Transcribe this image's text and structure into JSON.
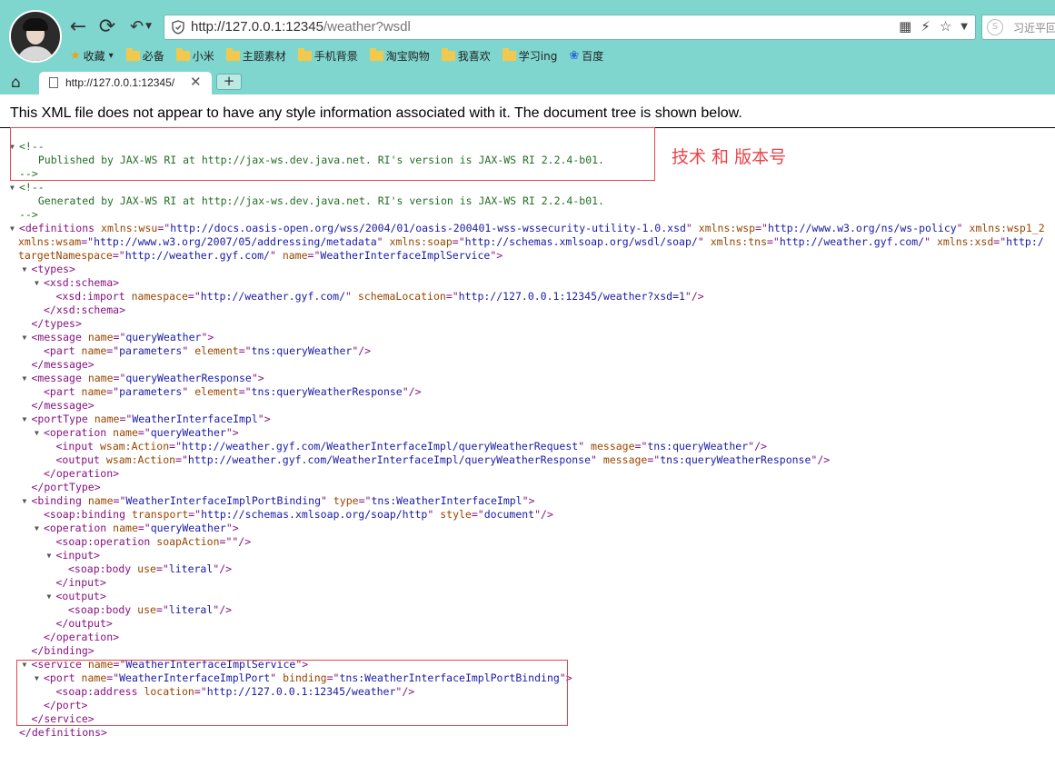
{
  "browser": {
    "address_url": "http://127.0.0.1:12345",
    "address_url_rest": "/weather?wsdl",
    "search_placeholder": "习近平回",
    "tab_title": "http://127.0.0.1:12345/",
    "new_tab_label": "+",
    "bookmarks": [
      {
        "label": "收藏",
        "icon": "star-icon"
      },
      {
        "label": "必备",
        "icon": "folder-icon"
      },
      {
        "label": "小米",
        "icon": "folder-icon"
      },
      {
        "label": "主题素材",
        "icon": "folder-icon"
      },
      {
        "label": "手机背景",
        "icon": "folder-icon"
      },
      {
        "label": "淘宝购物",
        "icon": "folder-icon"
      },
      {
        "label": "我喜欢",
        "icon": "folder-icon"
      },
      {
        "label": "学习ing",
        "icon": "folder-icon"
      },
      {
        "label": "百度",
        "icon": "baidu-paw-icon"
      }
    ],
    "theme_color": "#7fd6cf"
  },
  "page": {
    "info_message": "This XML file does not appear to have any style information associated with it. The document tree is shown below.",
    "annotation_text": "技术  和 版本号",
    "annotation_color": "#e8454a"
  },
  "xml_lines": [
    {
      "tri": true,
      "segs": [
        {
          "c": "cm",
          "t": "<!--"
        }
      ]
    },
    {
      "tri": false,
      "segs": [
        {
          "c": "cm",
          "t": "  Published by JAX-WS RI at http://jax-ws.dev.java.net. RI's version is JAX-WS RI 2.2.4-b01."
        }
      ]
    },
    {
      "tri": false,
      "segs": [
        {
          "c": "cm",
          "t": "-->"
        }
      ]
    },
    {
      "tri": true,
      "segs": [
        {
          "c": "cm",
          "t": "<!--"
        }
      ]
    },
    {
      "tri": false,
      "segs": [
        {
          "c": "cm",
          "t": "  Generated by JAX-WS RI at http://jax-ws.dev.java.net. RI's version is JAX-WS RI 2.2.4-b01."
        }
      ]
    },
    {
      "tri": false,
      "segs": [
        {
          "c": "cm",
          "t": "-->"
        }
      ]
    },
    {
      "tri": true,
      "segs": [
        {
          "c": "tg",
          "t": "<definitions "
        },
        {
          "c": "an",
          "t": "xmlns:wsu"
        },
        {
          "c": "tg",
          "t": "=\""
        },
        {
          "c": "av",
          "t": "http://docs.oasis-open.org/wss/2004/01/oasis-200401-wss-wssecurity-utility-1.0.xsd"
        },
        {
          "c": "tg",
          "t": "\" "
        },
        {
          "c": "an",
          "t": "xmlns:wsp"
        },
        {
          "c": "tg",
          "t": "=\""
        },
        {
          "c": "av",
          "t": "http://www.w3.org/ns/ws-policy"
        },
        {
          "c": "tg",
          "t": "\" "
        },
        {
          "c": "an",
          "t": "xmlns:wsp1_2"
        }
      ]
    },
    {
      "tri": false,
      "segs": [
        {
          "c": "an",
          "t": "xmlns:wsam"
        },
        {
          "c": "tg",
          "t": "=\""
        },
        {
          "c": "av",
          "t": "http://www.w3.org/2007/05/addressing/metadata"
        },
        {
          "c": "tg",
          "t": "\" "
        },
        {
          "c": "an",
          "t": "xmlns:soap"
        },
        {
          "c": "tg",
          "t": "=\""
        },
        {
          "c": "av",
          "t": "http://schemas.xmlsoap.org/wsdl/soap/"
        },
        {
          "c": "tg",
          "t": "\" "
        },
        {
          "c": "an",
          "t": "xmlns:tns"
        },
        {
          "c": "tg",
          "t": "=\""
        },
        {
          "c": "av",
          "t": "http://weather.gyf.com/"
        },
        {
          "c": "tg",
          "t": "\" "
        },
        {
          "c": "an",
          "t": "xmlns:xsd"
        },
        {
          "c": "tg",
          "t": "=\""
        },
        {
          "c": "av",
          "t": "http:/"
        }
      ]
    },
    {
      "tri": false,
      "segs": [
        {
          "c": "an",
          "t": "targetNamespace"
        },
        {
          "c": "tg",
          "t": "=\""
        },
        {
          "c": "av",
          "t": "http://weather.gyf.com/"
        },
        {
          "c": "tg",
          "t": "\" "
        },
        {
          "c": "an",
          "t": "name"
        },
        {
          "c": "tg",
          "t": "=\""
        },
        {
          "c": "av",
          "t": "WeatherInterfaceImplService"
        },
        {
          "c": "tg",
          "t": "\">"
        }
      ]
    },
    {
      "tri": true,
      "segs": [
        {
          "c": "tg",
          "t": "<types>"
        }
      ]
    },
    {
      "tri": true,
      "segs": [
        {
          "c": "tg",
          "t": "<xsd:schema>"
        }
      ]
    },
    {
      "tri": false,
      "segs": [
        {
          "c": "tg",
          "t": "<xsd:import "
        },
        {
          "c": "an",
          "t": "namespace"
        },
        {
          "c": "tg",
          "t": "=\""
        },
        {
          "c": "av",
          "t": "http://weather.gyf.com/"
        },
        {
          "c": "tg",
          "t": "\" "
        },
        {
          "c": "an",
          "t": "schemaLocation"
        },
        {
          "c": "tg",
          "t": "=\""
        },
        {
          "c": "av",
          "t": "http://127.0.0.1:12345/weather?xsd=1"
        },
        {
          "c": "tg",
          "t": "\"/>"
        }
      ]
    },
    {
      "tri": false,
      "segs": [
        {
          "c": "tg",
          "t": "</xsd:schema>"
        }
      ]
    },
    {
      "tri": false,
      "segs": [
        {
          "c": "tg",
          "t": "</types>"
        }
      ]
    },
    {
      "tri": true,
      "segs": [
        {
          "c": "tg",
          "t": "<message "
        },
        {
          "c": "an",
          "t": "name"
        },
        {
          "c": "tg",
          "t": "=\""
        },
        {
          "c": "av",
          "t": "queryWeather"
        },
        {
          "c": "tg",
          "t": "\">"
        }
      ]
    },
    {
      "tri": false,
      "segs": [
        {
          "c": "tg",
          "t": "<part "
        },
        {
          "c": "an",
          "t": "name"
        },
        {
          "c": "tg",
          "t": "=\""
        },
        {
          "c": "av",
          "t": "parameters"
        },
        {
          "c": "tg",
          "t": "\" "
        },
        {
          "c": "an",
          "t": "element"
        },
        {
          "c": "tg",
          "t": "=\""
        },
        {
          "c": "av",
          "t": "tns:queryWeather"
        },
        {
          "c": "tg",
          "t": "\"/>"
        }
      ]
    },
    {
      "tri": false,
      "segs": [
        {
          "c": "tg",
          "t": "</message>"
        }
      ]
    },
    {
      "tri": true,
      "segs": [
        {
          "c": "tg",
          "t": "<message "
        },
        {
          "c": "an",
          "t": "name"
        },
        {
          "c": "tg",
          "t": "=\""
        },
        {
          "c": "av",
          "t": "queryWeatherResponse"
        },
        {
          "c": "tg",
          "t": "\">"
        }
      ]
    },
    {
      "tri": false,
      "segs": [
        {
          "c": "tg",
          "t": "<part "
        },
        {
          "c": "an",
          "t": "name"
        },
        {
          "c": "tg",
          "t": "=\""
        },
        {
          "c": "av",
          "t": "parameters"
        },
        {
          "c": "tg",
          "t": "\" "
        },
        {
          "c": "an",
          "t": "element"
        },
        {
          "c": "tg",
          "t": "=\""
        },
        {
          "c": "av",
          "t": "tns:queryWeatherResponse"
        },
        {
          "c": "tg",
          "t": "\"/>"
        }
      ]
    },
    {
      "tri": false,
      "segs": [
        {
          "c": "tg",
          "t": "</message>"
        }
      ]
    },
    {
      "tri": true,
      "segs": [
        {
          "c": "tg",
          "t": "<portType "
        },
        {
          "c": "an",
          "t": "name"
        },
        {
          "c": "tg",
          "t": "=\""
        },
        {
          "c": "av",
          "t": "WeatherInterfaceImpl"
        },
        {
          "c": "tg",
          "t": "\">"
        }
      ]
    },
    {
      "tri": true,
      "segs": [
        {
          "c": "tg",
          "t": "<operation "
        },
        {
          "c": "an",
          "t": "name"
        },
        {
          "c": "tg",
          "t": "=\""
        },
        {
          "c": "av",
          "t": "queryWeather"
        },
        {
          "c": "tg",
          "t": "\">"
        }
      ]
    },
    {
      "tri": false,
      "segs": [
        {
          "c": "tg",
          "t": "<input "
        },
        {
          "c": "an",
          "t": "wsam:Action"
        },
        {
          "c": "tg",
          "t": "=\""
        },
        {
          "c": "av",
          "t": "http://weather.gyf.com/WeatherInterfaceImpl/queryWeatherRequest"
        },
        {
          "c": "tg",
          "t": "\" "
        },
        {
          "c": "an",
          "t": "message"
        },
        {
          "c": "tg",
          "t": "=\""
        },
        {
          "c": "av",
          "t": "tns:queryWeather"
        },
        {
          "c": "tg",
          "t": "\"/>"
        }
      ]
    },
    {
      "tri": false,
      "segs": [
        {
          "c": "tg",
          "t": "<output "
        },
        {
          "c": "an",
          "t": "wsam:Action"
        },
        {
          "c": "tg",
          "t": "=\""
        },
        {
          "c": "av",
          "t": "http://weather.gyf.com/WeatherInterfaceImpl/queryWeatherResponse"
        },
        {
          "c": "tg",
          "t": "\" "
        },
        {
          "c": "an",
          "t": "message"
        },
        {
          "c": "tg",
          "t": "=\""
        },
        {
          "c": "av",
          "t": "tns:queryWeatherResponse"
        },
        {
          "c": "tg",
          "t": "\"/>"
        }
      ]
    },
    {
      "tri": false,
      "segs": [
        {
          "c": "tg",
          "t": "</operation>"
        }
      ]
    },
    {
      "tri": false,
      "segs": [
        {
          "c": "tg",
          "t": "</portType>"
        }
      ]
    },
    {
      "tri": true,
      "segs": [
        {
          "c": "tg",
          "t": "<binding "
        },
        {
          "c": "an",
          "t": "name"
        },
        {
          "c": "tg",
          "t": "=\""
        },
        {
          "c": "av",
          "t": "WeatherInterfaceImplPortBinding"
        },
        {
          "c": "tg",
          "t": "\" "
        },
        {
          "c": "an",
          "t": "type"
        },
        {
          "c": "tg",
          "t": "=\""
        },
        {
          "c": "av",
          "t": "tns:WeatherInterfaceImpl"
        },
        {
          "c": "tg",
          "t": "\">"
        }
      ]
    },
    {
      "tri": false,
      "segs": [
        {
          "c": "tg",
          "t": "<soap:binding "
        },
        {
          "c": "an",
          "t": "transport"
        },
        {
          "c": "tg",
          "t": "=\""
        },
        {
          "c": "av",
          "t": "http://schemas.xmlsoap.org/soap/http"
        },
        {
          "c": "tg",
          "t": "\" "
        },
        {
          "c": "an",
          "t": "style"
        },
        {
          "c": "tg",
          "t": "=\""
        },
        {
          "c": "av",
          "t": "document"
        },
        {
          "c": "tg",
          "t": "\"/>"
        }
      ]
    },
    {
      "tri": true,
      "segs": [
        {
          "c": "tg",
          "t": "<operation "
        },
        {
          "c": "an",
          "t": "name"
        },
        {
          "c": "tg",
          "t": "=\""
        },
        {
          "c": "av",
          "t": "queryWeather"
        },
        {
          "c": "tg",
          "t": "\">"
        }
      ]
    },
    {
      "tri": false,
      "segs": [
        {
          "c": "tg",
          "t": "<soap:operation "
        },
        {
          "c": "an",
          "t": "soapAction"
        },
        {
          "c": "tg",
          "t": "=\"\"/>"
        }
      ]
    },
    {
      "tri": true,
      "segs": [
        {
          "c": "tg",
          "t": "<input>"
        }
      ]
    },
    {
      "tri": false,
      "segs": [
        {
          "c": "tg",
          "t": "<soap:body "
        },
        {
          "c": "an",
          "t": "use"
        },
        {
          "c": "tg",
          "t": "=\""
        },
        {
          "c": "av",
          "t": "literal"
        },
        {
          "c": "tg",
          "t": "\"/>"
        }
      ]
    },
    {
      "tri": false,
      "segs": [
        {
          "c": "tg",
          "t": "</input>"
        }
      ]
    },
    {
      "tri": true,
      "segs": [
        {
          "c": "tg",
          "t": "<output>"
        }
      ]
    },
    {
      "tri": false,
      "segs": [
        {
          "c": "tg",
          "t": "<soap:body "
        },
        {
          "c": "an",
          "t": "use"
        },
        {
          "c": "tg",
          "t": "=\""
        },
        {
          "c": "av",
          "t": "literal"
        },
        {
          "c": "tg",
          "t": "\"/>"
        }
      ]
    },
    {
      "tri": false,
      "segs": [
        {
          "c": "tg",
          "t": "</output>"
        }
      ]
    },
    {
      "tri": false,
      "segs": [
        {
          "c": "tg",
          "t": "</operation>"
        }
      ]
    },
    {
      "tri": false,
      "segs": [
        {
          "c": "tg",
          "t": "</binding>"
        }
      ]
    },
    {
      "tri": true,
      "segs": [
        {
          "c": "tg",
          "t": "<service "
        },
        {
          "c": "an",
          "t": "name"
        },
        {
          "c": "tg",
          "t": "=\""
        },
        {
          "c": "av",
          "t": "WeatherInterfaceImplService"
        },
        {
          "c": "tg",
          "t": "\">"
        }
      ]
    },
    {
      "tri": true,
      "segs": [
        {
          "c": "tg",
          "t": "<port "
        },
        {
          "c": "an",
          "t": "name"
        },
        {
          "c": "tg",
          "t": "=\""
        },
        {
          "c": "av",
          "t": "WeatherInterfaceImplPort"
        },
        {
          "c": "tg",
          "t": "\" "
        },
        {
          "c": "an",
          "t": "binding"
        },
        {
          "c": "tg",
          "t": "=\""
        },
        {
          "c": "av",
          "t": "tns:WeatherInterfaceImplPortBinding"
        },
        {
          "c": "tg",
          "t": "\">"
        }
      ]
    },
    {
      "tri": false,
      "segs": [
        {
          "c": "tg",
          "t": "<soap:address "
        },
        {
          "c": "an",
          "t": "location"
        },
        {
          "c": "tg",
          "t": "=\""
        },
        {
          "c": "av",
          "t": "http://127.0.0.1:12345/weather"
        },
        {
          "c": "tg",
          "t": "\"/>"
        }
      ]
    },
    {
      "tri": false,
      "segs": [
        {
          "c": "tg",
          "t": "</port>"
        }
      ]
    },
    {
      "tri": false,
      "segs": [
        {
          "c": "tg",
          "t": "</service>"
        }
      ]
    },
    {
      "tri": false,
      "segs": [
        {
          "c": "tg",
          "t": "</definitions>"
        }
      ]
    }
  ]
}
